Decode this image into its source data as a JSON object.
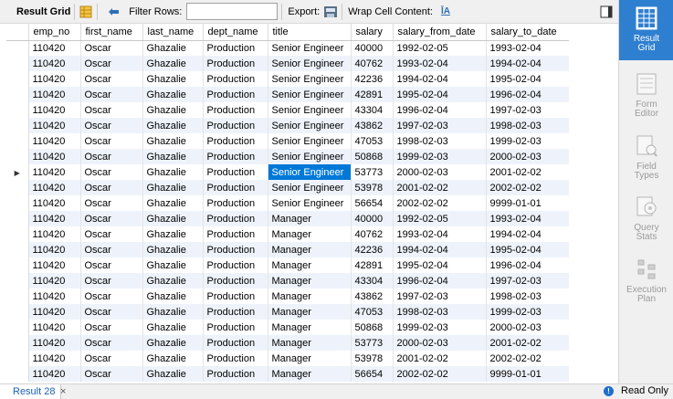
{
  "toolbar": {
    "result_grid_label": "Result Grid",
    "filter_rows_label": "Filter Rows:",
    "filter_rows_value": "",
    "export_label": "Export:",
    "wrap_cell_label": "Wrap Cell Content:",
    "wrap_icon_glyph": "ĪA"
  },
  "columns": [
    "emp_no",
    "first_name",
    "last_name",
    "dept_name",
    "title",
    "salary",
    "salary_from_date",
    "salary_to_date"
  ],
  "rows": [
    [
      "110420",
      "Oscar",
      "Ghazalie",
      "Production",
      "Senior Engineer",
      "40000",
      "1992-02-05",
      "1993-02-04"
    ],
    [
      "110420",
      "Oscar",
      "Ghazalie",
      "Production",
      "Senior Engineer",
      "40762",
      "1993-02-04",
      "1994-02-04"
    ],
    [
      "110420",
      "Oscar",
      "Ghazalie",
      "Production",
      "Senior Engineer",
      "42236",
      "1994-02-04",
      "1995-02-04"
    ],
    [
      "110420",
      "Oscar",
      "Ghazalie",
      "Production",
      "Senior Engineer",
      "42891",
      "1995-02-04",
      "1996-02-04"
    ],
    [
      "110420",
      "Oscar",
      "Ghazalie",
      "Production",
      "Senior Engineer",
      "43304",
      "1996-02-04",
      "1997-02-03"
    ],
    [
      "110420",
      "Oscar",
      "Ghazalie",
      "Production",
      "Senior Engineer",
      "43862",
      "1997-02-03",
      "1998-02-03"
    ],
    [
      "110420",
      "Oscar",
      "Ghazalie",
      "Production",
      "Senior Engineer",
      "47053",
      "1998-02-03",
      "1999-02-03"
    ],
    [
      "110420",
      "Oscar",
      "Ghazalie",
      "Production",
      "Senior Engineer",
      "50868",
      "1999-02-03",
      "2000-02-03"
    ],
    [
      "110420",
      "Oscar",
      "Ghazalie",
      "Production",
      "Senior Engineer",
      "53773",
      "2000-02-03",
      "2001-02-02"
    ],
    [
      "110420",
      "Oscar",
      "Ghazalie",
      "Production",
      "Senior Engineer",
      "53978",
      "2001-02-02",
      "2002-02-02"
    ],
    [
      "110420",
      "Oscar",
      "Ghazalie",
      "Production",
      "Senior Engineer",
      "56654",
      "2002-02-02",
      "9999-01-01"
    ],
    [
      "110420",
      "Oscar",
      "Ghazalie",
      "Production",
      "Manager",
      "40000",
      "1992-02-05",
      "1993-02-04"
    ],
    [
      "110420",
      "Oscar",
      "Ghazalie",
      "Production",
      "Manager",
      "40762",
      "1993-02-04",
      "1994-02-04"
    ],
    [
      "110420",
      "Oscar",
      "Ghazalie",
      "Production",
      "Manager",
      "42236",
      "1994-02-04",
      "1995-02-04"
    ],
    [
      "110420",
      "Oscar",
      "Ghazalie",
      "Production",
      "Manager",
      "42891",
      "1995-02-04",
      "1996-02-04"
    ],
    [
      "110420",
      "Oscar",
      "Ghazalie",
      "Production",
      "Manager",
      "43304",
      "1996-02-04",
      "1997-02-03"
    ],
    [
      "110420",
      "Oscar",
      "Ghazalie",
      "Production",
      "Manager",
      "43862",
      "1997-02-03",
      "1998-02-03"
    ],
    [
      "110420",
      "Oscar",
      "Ghazalie",
      "Production",
      "Manager",
      "47053",
      "1998-02-03",
      "1999-02-03"
    ],
    [
      "110420",
      "Oscar",
      "Ghazalie",
      "Production",
      "Manager",
      "50868",
      "1999-02-03",
      "2000-02-03"
    ],
    [
      "110420",
      "Oscar",
      "Ghazalie",
      "Production",
      "Manager",
      "53773",
      "2000-02-03",
      "2001-02-02"
    ],
    [
      "110420",
      "Oscar",
      "Ghazalie",
      "Production",
      "Manager",
      "53978",
      "2001-02-02",
      "2002-02-02"
    ],
    [
      "110420",
      "Oscar",
      "Ghazalie",
      "Production",
      "Manager",
      "56654",
      "2002-02-02",
      "9999-01-01"
    ]
  ],
  "selected": {
    "row": 8,
    "col": 4
  },
  "right_panel": [
    {
      "name": "result-grid",
      "label": "Result\nGrid",
      "active": true
    },
    {
      "name": "form-editor",
      "label": "Form\nEditor",
      "active": false
    },
    {
      "name": "field-types",
      "label": "Field\nTypes",
      "active": false
    },
    {
      "name": "query-stats",
      "label": "Query\nStats",
      "active": false
    },
    {
      "name": "execution-plan",
      "label": "Execution\nPlan",
      "active": false
    }
  ],
  "status": {
    "tab_label": "Result 28",
    "close_glyph": "×",
    "readonly_label": "Read Only",
    "info_glyph": "!"
  },
  "colors": {
    "selection": "#0078d7",
    "alt_row": "#eef3fb",
    "active_panel": "#2f7fd0"
  }
}
